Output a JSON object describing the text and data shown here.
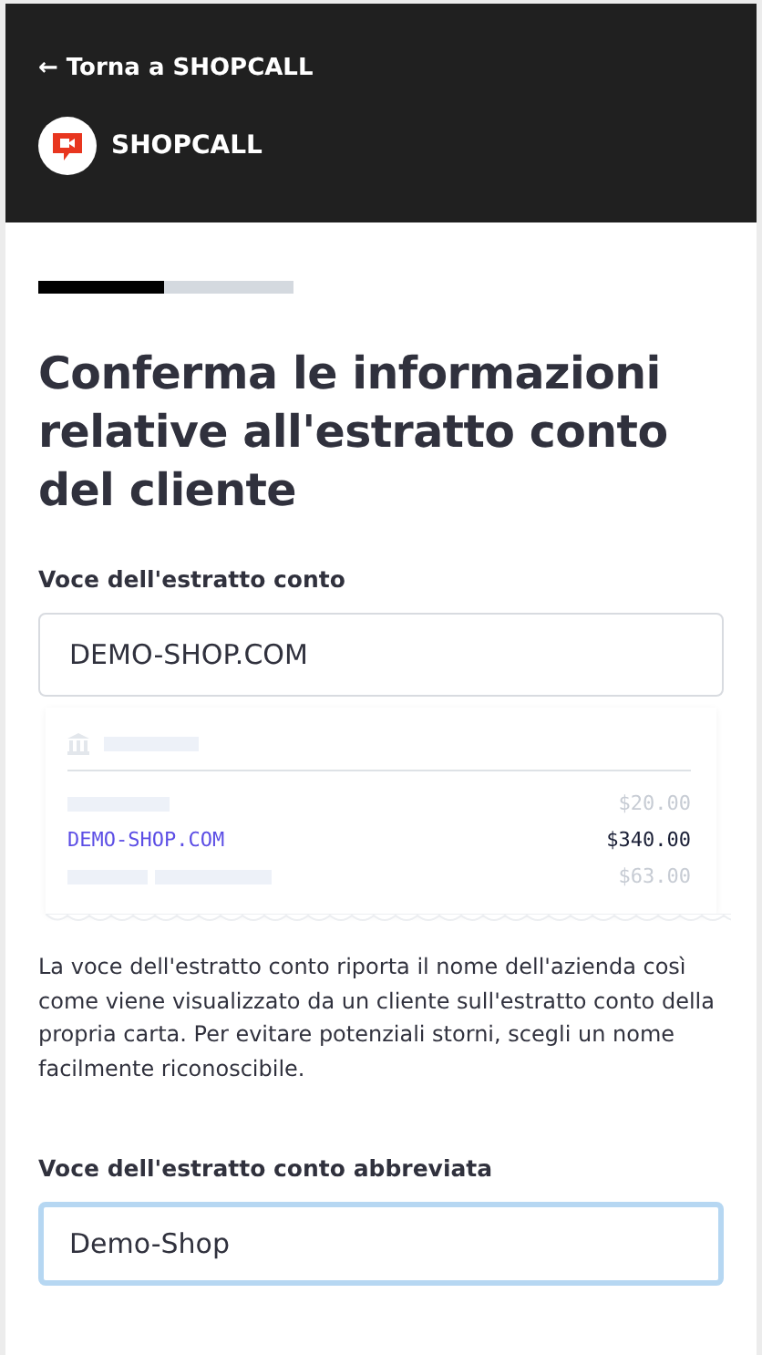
{
  "header": {
    "back_link": "← Torna a SHOPCALL",
    "brand": "SHOPCALL"
  },
  "progress": {
    "level": 0.49
  },
  "title": "Conferma le informazioni relative all'estratto conto del cliente",
  "statement_field": {
    "label": "Voce dell'estratto conto",
    "value": "DEMO-SHOP.COM",
    "focused": false
  },
  "receipt_preview": {
    "rows": [
      {
        "kind": "placeholder",
        "amount": "$20.00"
      },
      {
        "kind": "highlight",
        "name": "DEMO-SHOP.COM",
        "amount": "$340.00"
      },
      {
        "kind": "placeholder",
        "amount": "$63.00"
      }
    ]
  },
  "help_text": "La voce dell'estratto conto riporta il nome dell'azienda così come viene visualizzato da un cliente sull'estratto conto della propria carta. Per evitare potenziali storni, scegli un nome facilmente riconoscibile.",
  "short_field": {
    "label": "Voce dell'estratto conto abbreviata",
    "value": "Demo-Shop",
    "focused": true
  }
}
